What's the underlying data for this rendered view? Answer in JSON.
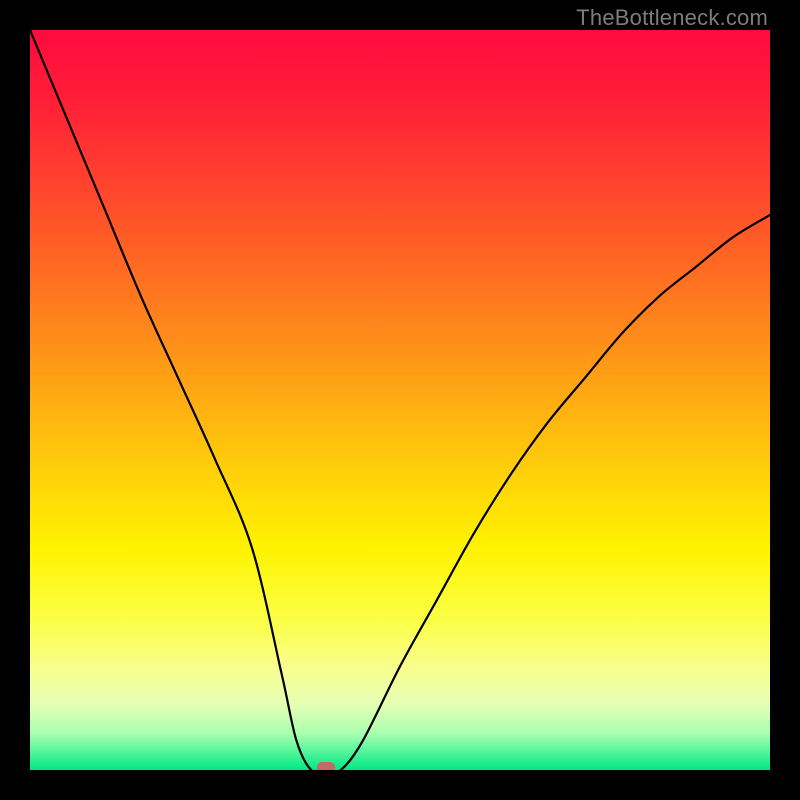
{
  "watermark": "TheBottleneck.com",
  "chart_data": {
    "type": "line",
    "title": "",
    "xlabel": "",
    "ylabel": "",
    "xlim": [
      0,
      100
    ],
    "ylim": [
      0,
      100
    ],
    "series": [
      {
        "name": "bottleneck-curve",
        "x": [
          0,
          5,
          10,
          15,
          20,
          25,
          30,
          34,
          36,
          38,
          40,
          42,
          45,
          50,
          55,
          60,
          65,
          70,
          75,
          80,
          85,
          90,
          95,
          100
        ],
        "values": [
          100,
          88,
          76,
          64,
          53,
          42,
          30,
          13,
          4,
          0,
          0,
          0,
          4,
          14,
          23,
          32,
          40,
          47,
          53,
          59,
          64,
          68,
          72,
          75
        ]
      }
    ],
    "marker": {
      "x": 40,
      "y": 0,
      "color": "#c26a6a"
    },
    "background_gradient": {
      "stops": [
        {
          "offset": 0.0,
          "color": "#ff0a3e"
        },
        {
          "offset": 0.1,
          "color": "#ff2037"
        },
        {
          "offset": 0.25,
          "color": "#ff5129"
        },
        {
          "offset": 0.4,
          "color": "#ff861b"
        },
        {
          "offset": 0.55,
          "color": "#ffbf0e"
        },
        {
          "offset": 0.7,
          "color": "#fff300"
        },
        {
          "offset": 0.8,
          "color": "#fbff48"
        },
        {
          "offset": 0.86,
          "color": "#f8ff8c"
        },
        {
          "offset": 0.91,
          "color": "#e7ffb4"
        },
        {
          "offset": 0.95,
          "color": "#aaffb0"
        },
        {
          "offset": 0.975,
          "color": "#55f59c"
        },
        {
          "offset": 1.0,
          "color": "#00e884"
        }
      ]
    }
  }
}
